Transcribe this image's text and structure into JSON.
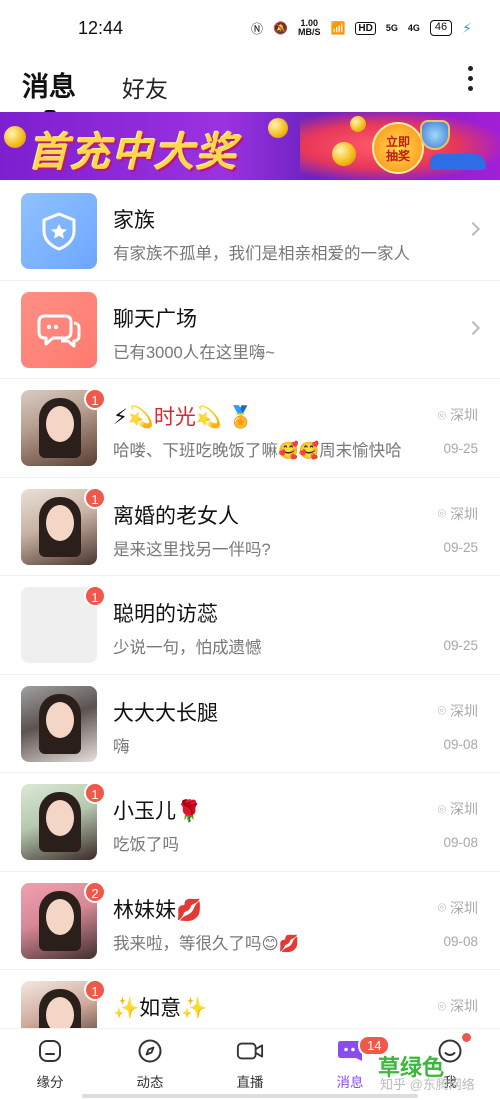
{
  "status_bar": {
    "time": "12:44",
    "speed_top": "1.00",
    "speed_bottom": "MB/S",
    "net1": "5G",
    "net2": "4G",
    "battery": "46"
  },
  "header": {
    "tab_messages": "消息",
    "tab_friends": "好友"
  },
  "banner": {
    "title": "首充中大奖",
    "badge_line1": "立即",
    "badge_line2": "抽奖"
  },
  "list": [
    {
      "name": "家族",
      "sub": "有家族不孤单，我们是相亲相爱的一家人"
    },
    {
      "name": "聊天广场",
      "sub": "已有3000人在这里嗨~"
    },
    {
      "name_pre": "⚡💫",
      "name_red": "时光",
      "name_post": "💫 🏅",
      "sub": "哈喽、下班吃晚饭了嘛🥰🥰周末愉快哈",
      "location": "深圳",
      "date": "09-25",
      "badge": "1"
    },
    {
      "name": "离婚的老女人",
      "sub": "是来这里找另一伴吗?",
      "location": "深圳",
      "date": "09-25",
      "badge": "1"
    },
    {
      "name": "聪明的访蕊",
      "sub": "少说一句，怕成遗憾",
      "date": "09-25",
      "badge": "1"
    },
    {
      "name": "大大大长腿",
      "sub": "嗨",
      "location": "深圳",
      "date": "09-08"
    },
    {
      "name": "小玉儿🌹",
      "sub": "吃饭了吗",
      "location": "深圳",
      "date": "09-08",
      "badge": "1"
    },
    {
      "name": "林妹妹💋",
      "sub": "我来啦，等很久了吗😊💋",
      "location": "深圳",
      "date": "09-08",
      "badge": "2"
    },
    {
      "name": "✨如意✨",
      "location": "深圳",
      "badge": "1"
    }
  ],
  "bottom_nav": {
    "items": [
      {
        "label": "缘分"
      },
      {
        "label": "动态"
      },
      {
        "label": "直播"
      },
      {
        "label": "消息",
        "badge": "14"
      },
      {
        "label": "我"
      }
    ]
  },
  "watermark": {
    "text": "草绿色",
    "sub": "知乎 @东腾网络"
  },
  "colors": {
    "accent": "#8a4cf0",
    "badge": "#f0584a",
    "family_icon_bg": "#7cb4ff",
    "chat_icon_bg": "#ff8478"
  }
}
